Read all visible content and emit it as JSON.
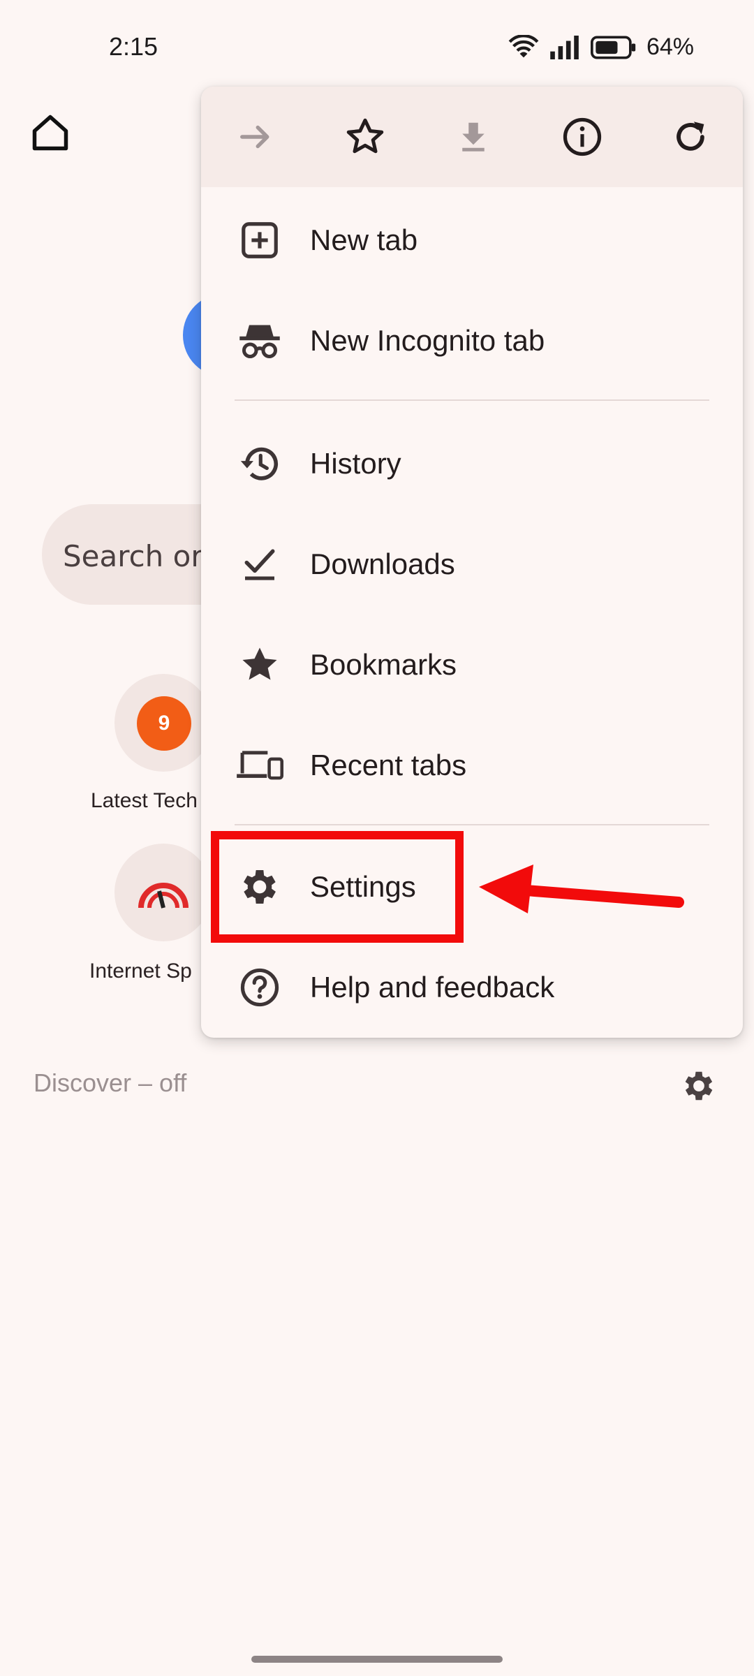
{
  "status_bar": {
    "time": "2:15",
    "battery_percent": "64%",
    "icons": [
      "wifi-icon",
      "signal-icon",
      "battery-icon"
    ]
  },
  "background": {
    "search_placeholder": "Search or",
    "tiles": [
      {
        "label": "Latest Tech",
        "badge": "9",
        "icon": "site-badge-icon"
      },
      {
        "label": "Internet Sp",
        "icon": "speedometer-icon"
      }
    ],
    "discover_label": "Discover – off"
  },
  "menu": {
    "top_icons": [
      "forward-icon",
      "bookmark-star-icon",
      "download-icon",
      "info-icon",
      "refresh-icon"
    ],
    "items": [
      {
        "label": "New tab",
        "icon": "new-tab-icon"
      },
      {
        "label": "New Incognito tab",
        "icon": "incognito-icon"
      },
      {
        "label": "History",
        "icon": "history-icon"
      },
      {
        "label": "Downloads",
        "icon": "downloads-icon"
      },
      {
        "label": "Bookmarks",
        "icon": "star-icon"
      },
      {
        "label": "Recent tabs",
        "icon": "devices-icon"
      },
      {
        "label": "Settings",
        "icon": "gear-icon"
      },
      {
        "label": "Help and feedback",
        "icon": "help-icon"
      }
    ]
  },
  "annotation": {
    "highlight_color": "#f20b0b"
  }
}
